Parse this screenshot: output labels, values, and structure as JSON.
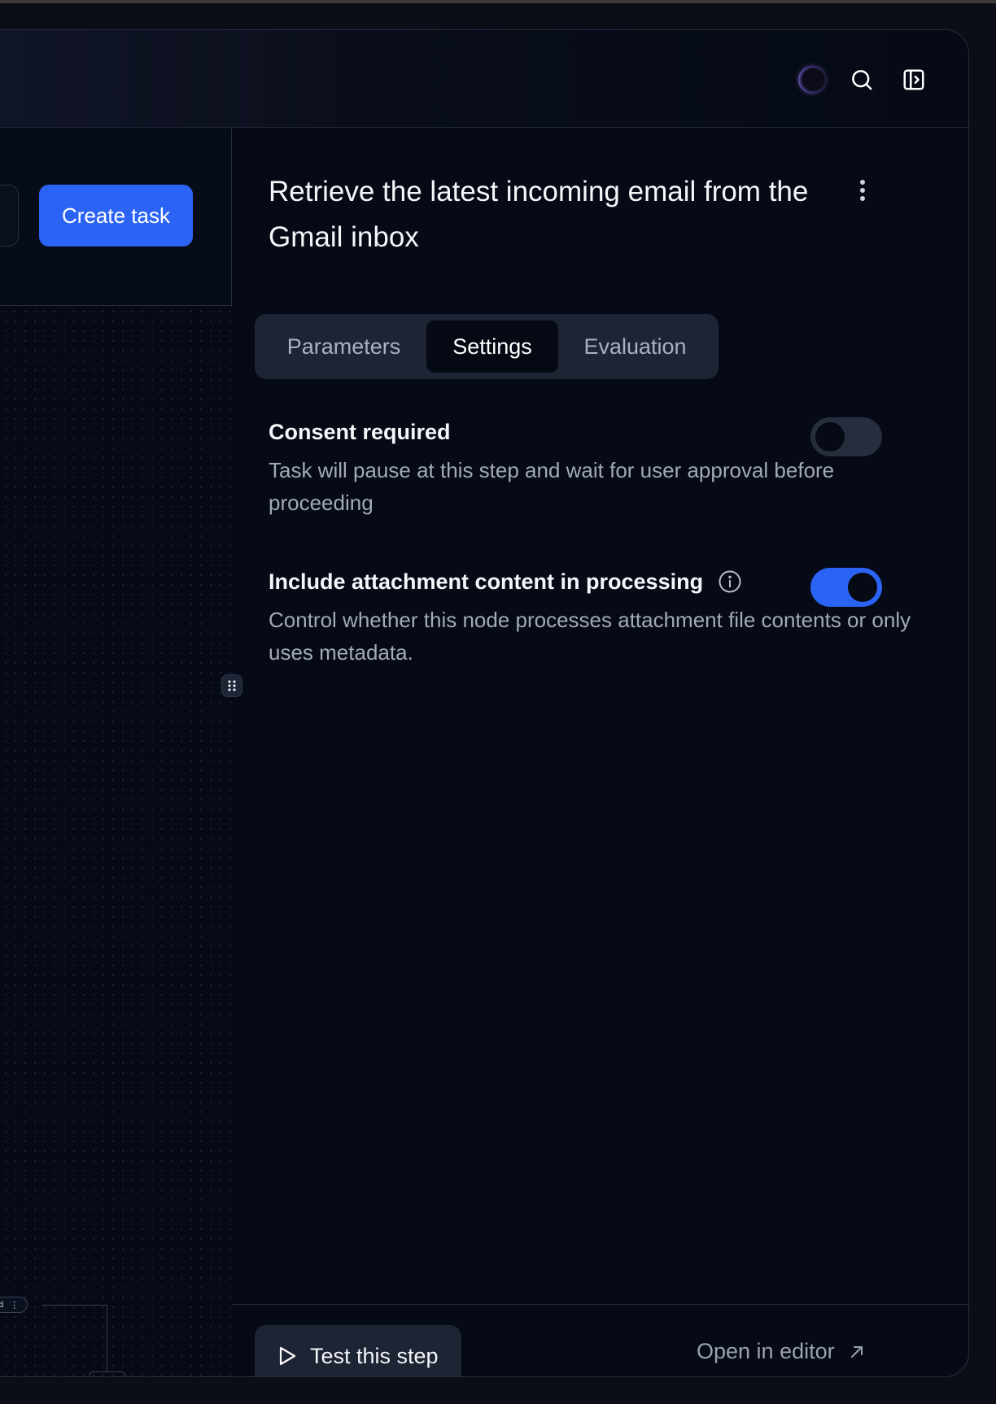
{
  "header": {
    "icons": [
      "avatar-orb",
      "search-icon",
      "sidebar-toggle-icon"
    ]
  },
  "left_pane": {
    "create_task_label": "Create task",
    "node_chip_label": "nvalid"
  },
  "panel": {
    "title": "Retrieve the latest incoming email from the Gmail inbox",
    "tabs": [
      {
        "label": "Parameters",
        "active": false
      },
      {
        "label": "Settings",
        "active": true
      },
      {
        "label": "Evaluation",
        "active": false
      }
    ],
    "settings": [
      {
        "label": "Consent required",
        "description": "Task will pause at this step and wait for user approval before proceeding",
        "enabled": false
      },
      {
        "label": "Include attachment content in processing",
        "description": "Control whether this node processes attachment file contents or only uses metadata.",
        "enabled": true
      }
    ],
    "footer": {
      "test_label": "Test this step",
      "open_editor_label": "Open in editor"
    }
  },
  "colors": {
    "accent": "#2b63f5",
    "background": "#050a16",
    "surface": "#1d2433",
    "muted_text": "#a2a9b8"
  }
}
